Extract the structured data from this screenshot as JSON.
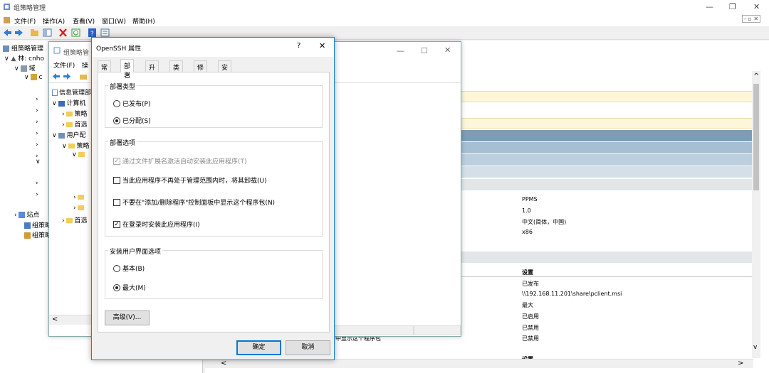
{
  "main": {
    "title": "组策略管理",
    "menu": [
      "文件(F)",
      "操作(A)",
      "查看(V)",
      "窗口(W)",
      "帮助(H)"
    ],
    "controls": {
      "minimize": "—",
      "restore": "❐",
      "close": "✕"
    },
    "inner_controls": "- ▫ ✕"
  },
  "tree": {
    "root": "组策略管理",
    "forest": "林: cnho",
    "domains": "域",
    "domain_node": "c",
    "sites": "站点",
    "gpo_model": "组策略",
    "gpo_result": "组策略"
  },
  "editor": {
    "title": "组策略管",
    "menu": [
      "文件(F)",
      "操"
    ],
    "items": {
      "root": "信息管理部",
      "computer": "计算机",
      "policies1": "策略",
      "prefs1": "首选",
      "user": "用户配",
      "policies2": "策略",
      "prefs2": "首选"
    },
    "scroll_left": "<"
  },
  "bg_window": {
    "controls": {
      "minimize": "—",
      "restore": "☐",
      "close": "✕"
    }
  },
  "dialog": {
    "title": "OpenSSH 属性",
    "help": "?",
    "close": "✕",
    "tabs": [
      "常规",
      "部署",
      "升级",
      "类别",
      "修改",
      "安全"
    ],
    "deploy_type": {
      "label": "部署类型",
      "published": "已发布(P)",
      "assigned": "已分配(S)"
    },
    "deploy_options": {
      "label": "部署选项",
      "auto_install": "通过文件扩展名激活自动安装此应用程序(T)",
      "uninstall": "当此应用程序不再处于管理范围内时，将其卸载(U)",
      "hide_arp": "不要在\"添加/删除程序\"控制面板中显示这个程序包(N)",
      "install_logon": "在登录时安装此应用程序(I)"
    },
    "ui_options": {
      "label": "安装用户界面选项",
      "basic": "基本(B)",
      "max": "最大(M)"
    },
    "advanced": "高级(V)...",
    "ok": "确定",
    "cancel": "取消"
  },
  "details": {
    "values_top": [
      "PPMS",
      "1.0",
      "中文(简体，中国)",
      "x86"
    ],
    "settings_header": "设置",
    "settings_values": [
      "已发布",
      "\\\\192.168.11.201\\share\\pclient.msi",
      "最大",
      "已启用",
      "已禁用",
      "已禁用"
    ],
    "partial_label": "中显示这个程序包",
    "bottom_header": "设置",
    "scroll_up": "^",
    "scroll_down": "v",
    "scroll_left": "<",
    "scroll_right": ">"
  },
  "colors": {
    "band_yellow": "#fdf6d8",
    "band_blue_dark": "#7d9db6",
    "band_blue_mid": "#a6bfd2",
    "band_blue_light": "#c6d7e4",
    "band_gray": "#e9edf0",
    "accent": "#0078d7"
  }
}
